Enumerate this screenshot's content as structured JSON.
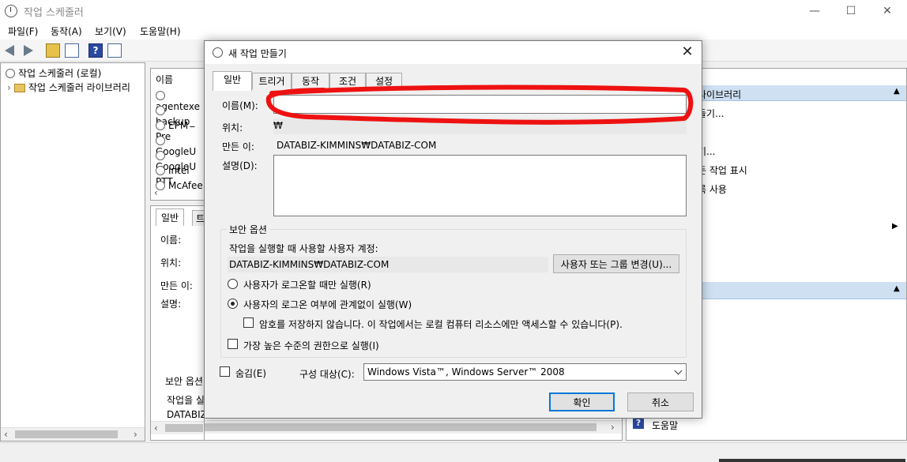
{
  "window": {
    "title": "작업 스케줄러",
    "minimize": "—",
    "maximize": "☐",
    "close": "✕"
  },
  "menu": [
    "파일(F)",
    "동작(A)",
    "보기(V)",
    "도움말(H)"
  ],
  "tree": {
    "root": "작업 스케줄러 (로컬)",
    "library": "작업 스케줄러 라이브러리"
  },
  "task_list": {
    "header": "이름",
    "rows": [
      "agentexe",
      "backup_",
      "EPM Pre",
      "GoogleU",
      "GoogleU",
      "Intel PTT",
      "McAfee"
    ]
  },
  "detail": {
    "tab": "일반",
    "tab2": "트",
    "name_label": "이름:",
    "location_label": "위치:",
    "author_label": "만든 이:",
    "description_label": "설명:",
    "security_label": "보안 옵션",
    "run_as_label": "작업을 실",
    "account_value": "DATABIZ-COM"
  },
  "actions_pane": {
    "header": "라이브러리",
    "items": [
      "들기...",
      "기...",
      "든 작업 표시",
      "록 사용"
    ],
    "help": "도움말"
  },
  "dialog": {
    "title": "새 작업 만들기",
    "close": "✕",
    "tabs": [
      "일반",
      "트리거",
      "동작",
      "조건",
      "설정"
    ],
    "name_label": "이름(M):",
    "name_value": "",
    "location_label": "위치:",
    "location_value": "₩",
    "author_label": "만든 이:",
    "author_value": "DATABIZ-KIMMINS₩DATABIZ-COM",
    "description_label": "설명(D):",
    "description_value": "",
    "security": {
      "title": "보안 옵션",
      "account_prompt": "작업을 실행할 때 사용할 사용자 계정:",
      "account_value": "DATABIZ-KIMMINS₩DATABIZ-COM",
      "change_button": "사용자 또는 그룹 변경(U)...",
      "radio_logged_on": "사용자가 로그온할 때만 실행(R)",
      "radio_always": "사용자의 로그온 여부에 관계없이 실행(W)",
      "no_store_password": "암호를 저장하지 않습니다. 이 작업에서는 로컬 컴퓨터 리소스에만 액세스할 수 있습니다(P).",
      "highest_privileges": "가장 높은 수준의 권한으로 실행(I)"
    },
    "hidden_label": "숨김(E)",
    "configure_label": "구성 대상(C):",
    "configure_value": "Windows Vista™, Windows Server™ 2008",
    "ok_button": "확인",
    "cancel_button": "취소"
  },
  "colors": {
    "accent": "#0078d7",
    "annotation_red": "#ee1111"
  }
}
